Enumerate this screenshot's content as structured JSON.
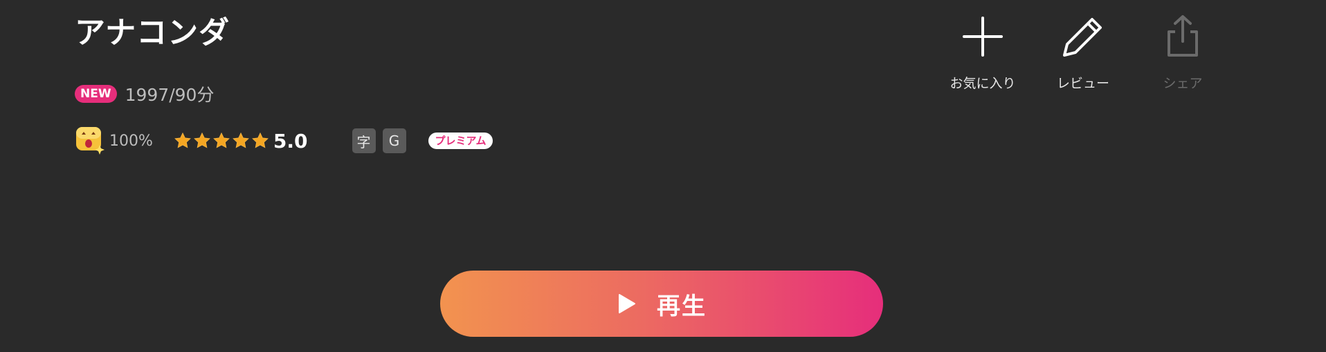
{
  "title": "アナコンダ",
  "meta": {
    "new_badge": "NEW",
    "year_duration": "1997/90分"
  },
  "stats": {
    "emoji_icon": "wow-face-icon",
    "reaction_percent": "100%",
    "rating_value": 5.0,
    "rating_label": "5.0",
    "star_count": 5,
    "tags": [
      "字",
      "G"
    ],
    "premium_badge": "プレミアム"
  },
  "actions": [
    {
      "label": "お気に入り",
      "icon": "plus-icon",
      "enabled": true
    },
    {
      "label": "レビュー",
      "icon": "pencil-icon",
      "enabled": true
    },
    {
      "label": "シェア",
      "icon": "share-icon",
      "enabled": false
    }
  ],
  "play_button": {
    "label": "再生",
    "icon": "play-icon"
  },
  "colors": {
    "background": "#2a2a2a",
    "accent_pink": "#e62e7b",
    "accent_orange": "#f2934f",
    "star": "#f4a623"
  }
}
